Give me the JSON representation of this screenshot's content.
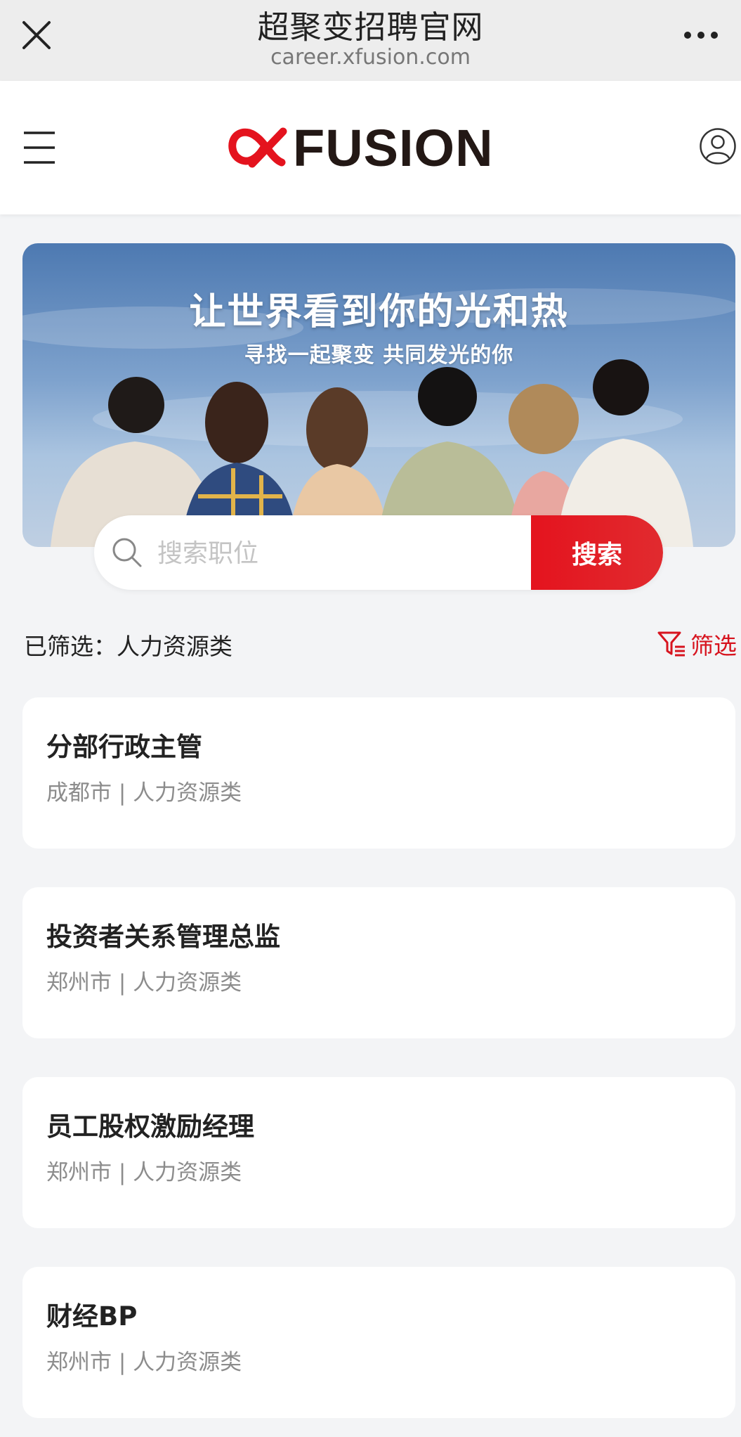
{
  "browser": {
    "title": "超聚变招聘官网",
    "url": "career.xfusion.com"
  },
  "header": {
    "logo_text": "FUSION",
    "logo_mark": "∝",
    "icons": [
      "menu-icon",
      "user-icon"
    ],
    "brand_color": "#e4131e"
  },
  "banner": {
    "title": "让世界看到你的光和热",
    "subtitle": "寻找一起聚变 共同发光的你"
  },
  "search": {
    "placeholder": "搜索职位",
    "value": "",
    "button_label": "搜索"
  },
  "filter": {
    "selected_label": "已筛选：人力资源类",
    "button_label": "筛选"
  },
  "jobs": [
    {
      "title": "分部行政主管",
      "meta": "成都市 | 人力资源类"
    },
    {
      "title": "投资者关系管理总监",
      "meta": "郑州市 | 人力资源类"
    },
    {
      "title": "员工股权激励经理",
      "meta": "郑州市 | 人力资源类"
    },
    {
      "title": "财经BP",
      "meta": "郑州市 | 人力资源类"
    }
  ]
}
